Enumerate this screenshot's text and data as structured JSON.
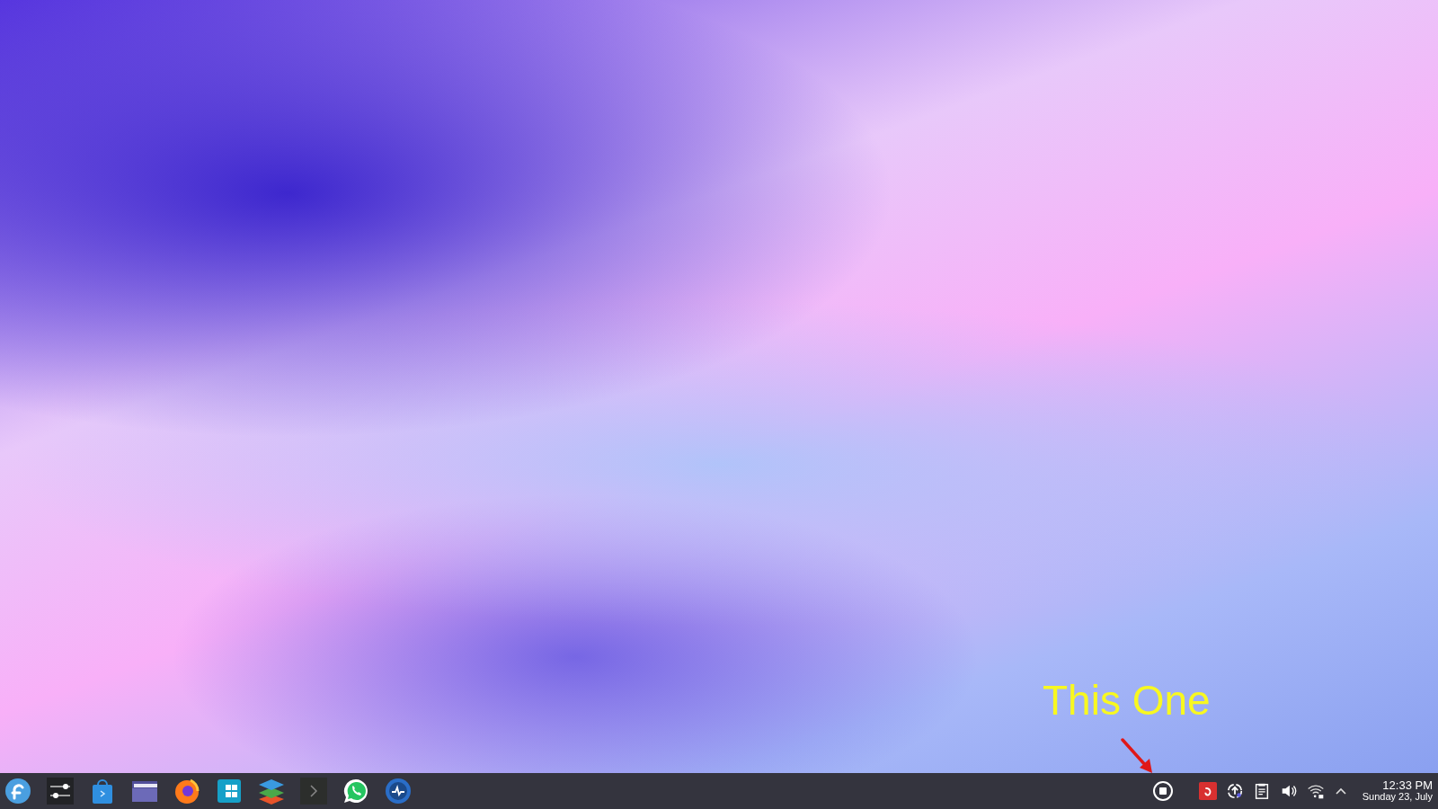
{
  "annotation": {
    "text": "This One"
  },
  "clock": {
    "time": "12:33 PM",
    "date": "Sunday 23, July"
  }
}
